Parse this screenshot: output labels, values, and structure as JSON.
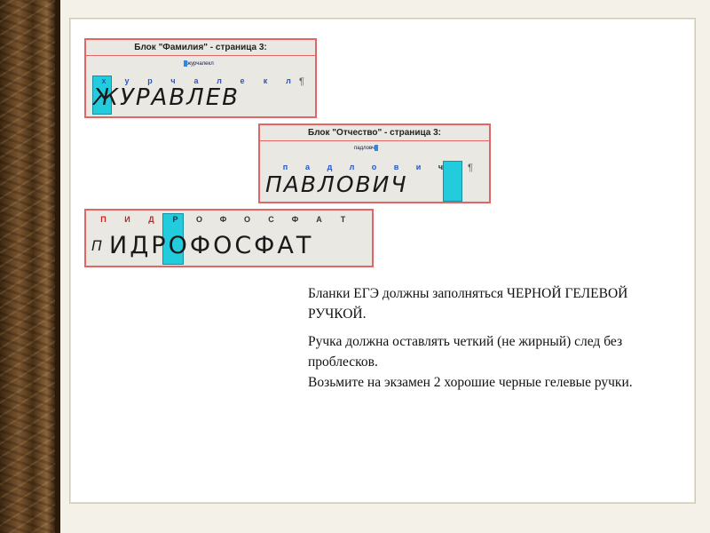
{
  "palette": {
    "highlight": "#22ccdd",
    "border": "#e06666",
    "letters_blue": "#2255cc",
    "letters_red": "#cc2222"
  },
  "surname_block": {
    "title": "Блок \"Фамилия\" - страница 3:",
    "typed_word": "журчалекл",
    "letters": [
      "х",
      "у",
      "р",
      "ч",
      "а",
      "л",
      "е",
      "к",
      "л"
    ],
    "handwriting": "ЖУРАВЛЕВ",
    "pilcrow": "¶"
  },
  "patronymic_block": {
    "title": "Блок \"Отчество\" - страница 3:",
    "typed_word": "падловч",
    "letters": [
      "п",
      "а",
      "д",
      "л",
      "о",
      "в",
      "и",
      "ч"
    ],
    "handwriting": "ПАВЛОВИЧ",
    "pilcrow": "¶"
  },
  "third_block": {
    "letters": [
      "П",
      "И",
      "Д",
      "Р",
      "О",
      "Ф",
      "О",
      "С",
      "Ф",
      "А",
      "Т"
    ],
    "handwriting": "ИДРОФОСФАТ",
    "prefix": "П"
  },
  "caption": {
    "p1": "Бланки  ЕГЭ должны заполняться ЧЕРНОЙ ГЕЛЕВОЙ РУЧКОЙ.",
    "p2_line1": "Ручка должна оставлять четкий (не жирный) след без проблесков.",
    "p2_line2": "Возьмите на экзамен 2 хорошие черные гелевые ручки."
  }
}
